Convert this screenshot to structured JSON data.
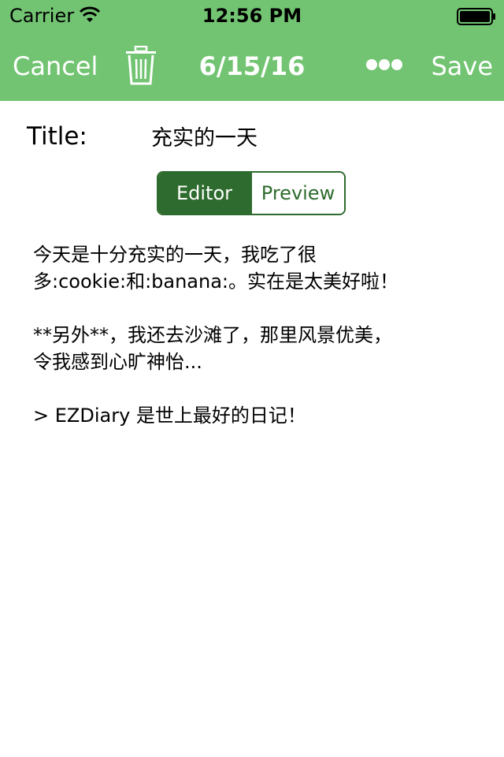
{
  "status_bar": {
    "carrier": "Carrier",
    "time": "12:56 PM"
  },
  "nav": {
    "cancel_label": "Cancel",
    "title": "6/15/16",
    "save_label": "Save"
  },
  "form": {
    "title_label": "Title:",
    "title_value": "充实的一天"
  },
  "segmented": {
    "editor_label": "Editor",
    "preview_label": "Preview",
    "selected": "Editor"
  },
  "content": {
    "line1": "今天是十分充实的一天，我吃了很",
    "line2": "多:cookie:和:banana:。实在是太美好啦！",
    "line3": "**另外**，我还去沙滩了，那里风景优美，",
    "line4": "令我感到心旷神怡...",
    "line5": "> EZDiary 是世上最好的日记！"
  },
  "colors": {
    "nav_background": "#72c472",
    "segment_accent": "#2e6b2e"
  },
  "icons": {
    "wifi": "wifi-icon",
    "battery": "battery-icon",
    "trash": "trash-icon",
    "more": "more-icon"
  }
}
